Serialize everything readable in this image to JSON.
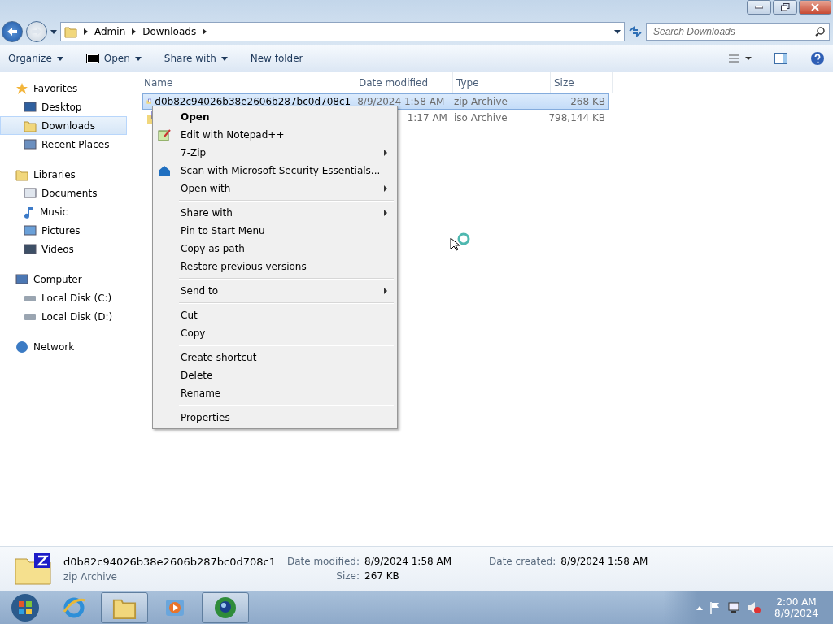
{
  "address": {
    "crumbs": [
      "Admin",
      "Downloads"
    ]
  },
  "search": {
    "placeholder": "Search Downloads"
  },
  "toolbar": {
    "buttons": [
      {
        "label": "Organize",
        "dropdown": true,
        "kind": "plain"
      },
      {
        "label": "Open",
        "dropdown": true,
        "kind": "sevenzip"
      },
      {
        "label": "Share with",
        "dropdown": true,
        "kind": "plain"
      },
      {
        "label": "New folder",
        "dropdown": false,
        "kind": "plain"
      }
    ]
  },
  "sidebar": {
    "items": [
      {
        "label": "Favorites",
        "kind": "star",
        "selected": false,
        "children": [
          {
            "label": "Desktop",
            "kind": "desktop",
            "selected": false
          },
          {
            "label": "Downloads",
            "kind": "downloads",
            "selected": true
          },
          {
            "label": "Recent Places",
            "kind": "recent",
            "selected": false
          }
        ]
      },
      {
        "label": "Libraries",
        "kind": "libraries",
        "selected": false,
        "children": [
          {
            "label": "Documents",
            "kind": "documents",
            "selected": false
          },
          {
            "label": "Music",
            "kind": "music",
            "selected": false
          },
          {
            "label": "Pictures",
            "kind": "pictures",
            "selected": false
          },
          {
            "label": "Videos",
            "kind": "videos",
            "selected": false
          }
        ]
      },
      {
        "label": "Computer",
        "kind": "computer",
        "selected": false,
        "children": [
          {
            "label": "Local Disk (C:)",
            "kind": "disk",
            "selected": false
          },
          {
            "label": "Local Disk (D:)",
            "kind": "disk",
            "selected": false
          }
        ]
      },
      {
        "label": "Network",
        "kind": "network",
        "selected": false
      }
    ]
  },
  "table": {
    "columns": [
      "Name",
      "Date modified",
      "Type",
      "Size"
    ],
    "rows": [
      {
        "name": "d0b82c94026b38e2606b287bc0d708c1",
        "date": "8/9/2024 1:58 AM",
        "type": "zip Archive",
        "size": "268 KB",
        "kind": "zip",
        "selected": true
      },
      {
        "date": "1:17 AM",
        "type": "iso Archive",
        "size": "798,144 KB",
        "kind": "iso",
        "selected": false
      }
    ]
  },
  "context_menu": {
    "groups": [
      [
        {
          "label": "Open",
          "bold": true,
          "submenu": false
        },
        {
          "label": "Edit with Notepad++",
          "bold": false,
          "submenu": false,
          "kind": "notepad"
        },
        {
          "label": "7-Zip",
          "bold": false,
          "submenu": true
        },
        {
          "label": "Scan with Microsoft Security Essentials...",
          "bold": false,
          "submenu": false,
          "kind": "shield"
        },
        {
          "label": "Open with",
          "bold": false,
          "submenu": true
        }
      ],
      [
        {
          "label": "Share with",
          "bold": false,
          "submenu": true
        },
        {
          "label": "Pin to Start Menu",
          "bold": false,
          "submenu": false
        },
        {
          "label": "Copy as path",
          "bold": false,
          "submenu": false
        },
        {
          "label": "Restore previous versions",
          "bold": false,
          "submenu": false
        }
      ],
      [
        {
          "label": "Send to",
          "bold": false,
          "submenu": true
        }
      ],
      [
        {
          "label": "Cut",
          "bold": false,
          "submenu": false
        },
        {
          "label": "Copy",
          "bold": false,
          "submenu": false
        }
      ],
      [
        {
          "label": "Create shortcut",
          "bold": false,
          "submenu": false
        },
        {
          "label": "Delete",
          "bold": false,
          "submenu": false
        },
        {
          "label": "Rename",
          "bold": false,
          "submenu": false
        }
      ],
      [
        {
          "label": "Properties",
          "bold": false,
          "submenu": false
        }
      ]
    ]
  },
  "details": {
    "name": "d0b82c94026b38e2606b287bc0d708c1",
    "type": "zip Archive",
    "fields": [
      {
        "label": "Date modified:",
        "value": "8/9/2024 1:58 AM"
      },
      {
        "label": "Size:",
        "value": "267 KB"
      },
      {
        "label": "Date created:",
        "value": "8/9/2024 1:58 AM"
      }
    ]
  },
  "taskbar": {
    "items": [
      {
        "kind": "ie",
        "open": false
      },
      {
        "kind": "explorer",
        "open": true
      },
      {
        "kind": "media",
        "open": false
      },
      {
        "kind": "globe",
        "open": true
      }
    ],
    "time": "2:00 AM",
    "date": "8/9/2024"
  }
}
